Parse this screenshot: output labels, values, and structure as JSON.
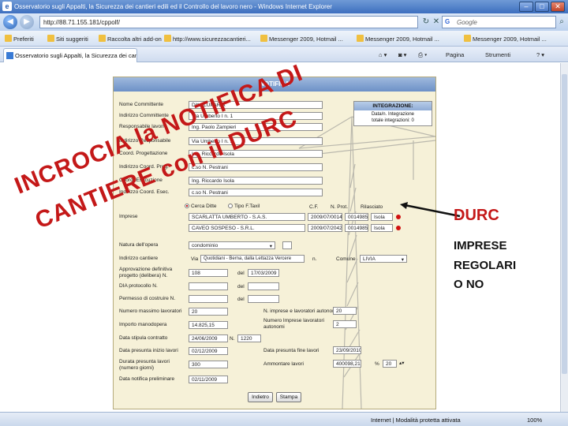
{
  "window": {
    "title": "Osservatorio sugli Appalti, la Sicurezza dei cantieri edili ed il Controllo del lavoro nero - Windows Internet Explorer"
  },
  "addressbar": {
    "url": "http://88.71.155.181/cppolf/",
    "search_placeholder": "Google"
  },
  "favorites": [
    {
      "label": "Preferiti"
    },
    {
      "label": "Siti suggeriti"
    },
    {
      "label": "Raccolta altri add-on"
    },
    {
      "label": "http://www.sicurezzacantieri..."
    },
    {
      "label": "Messenger 2009, Hotmail ..."
    },
    {
      "label": "Messenger 2009, Hotmail ..."
    },
    {
      "label": "Messenger 2009, Hotmail ..."
    }
  ],
  "tab": {
    "label": "Osservatorio sugli Appalti, la Sicurezza dei cantieri..."
  },
  "commandbar": {
    "page": "Pagina",
    "tools": "Strumenti"
  },
  "status": {
    "text": "Internet | Modalità protetta attivata",
    "zoom": "100%"
  },
  "form": {
    "header": "NOTIFICA",
    "fields": [
      {
        "label": "Nome Committente",
        "value": "Ditta LUPARIA"
      },
      {
        "label": "Indirizzo Committente",
        "value": "Via Umberto I n. 1"
      },
      {
        "label": "Responsabile lavori",
        "value": "Ing. Paolo Zampieri"
      },
      {
        "label": "Indirizzo Responsabile",
        "value": "Via Umberto I n. 1"
      },
      {
        "label": "Coord. Progettazione",
        "value": "Ing. Riccardo Isola"
      },
      {
        "label": "Indirizzo Coord. Prog.",
        "value": "c.so N. Pestrani"
      },
      {
        "label": "Coord. Esecuzione",
        "value": "Ing. Riccardo Isola"
      },
      {
        "label": "Indirizzo Coord. Esec.",
        "value": "c.so N. Pestrani"
      }
    ],
    "integration": {
      "title": "INTEGRAZIONE:",
      "line1": "Data/n. Integrazione",
      "line2": "totale integrazioni: 0"
    },
    "imprese": {
      "label": "Imprese",
      "radio1": "Cerca Ditte",
      "radio2": "Tipo F.Taxil",
      "col_cf": "C.F.",
      "col_prot": "N. Prot.",
      "col_rilascio": "Rilasciato",
      "rows": [
        {
          "name": "SCARLATTA UMBERTO - S.A.S.",
          "cf": "2009/07/001455",
          "prot": "0014985",
          "date": "Isola"
        },
        {
          "name": "CAVEO SOSPESO - S.R.L.",
          "cf": "2009/07/204293",
          "prot": "0014985",
          "date": "Isola"
        }
      ]
    },
    "natura": {
      "label": "Natura dell'opera",
      "value": "condominio"
    },
    "indirizzo_cantiere": {
      "label": "Indirizzo cantiere",
      "prefix": "Via",
      "value": "Quotidiani - Berna, dalla Lettazza Vercere",
      "n_label": "n.",
      "comune_label": "Comune",
      "comune": "LIVIA"
    },
    "approvazione": {
      "label": "Approvazione definitiva progetto (delibera) N.",
      "value": "108",
      "del": "del",
      "date": "17/03/2009"
    },
    "dia": {
      "label": "DIA protocollo N.",
      "del": "del"
    },
    "permesso": {
      "label": "Permesso di costruire N.",
      "del": "del"
    },
    "lavoratori": {
      "label": "Numero massimo lavoratori",
      "value": "20",
      "label2": "N. imprese e lavoratori autonomi",
      "value2": "20"
    },
    "importo": {
      "label": "Importo manodopera",
      "value": "14.825,15",
      "label2": "Numero Imprese lavoratori autonomi",
      "value2": "2"
    },
    "contratto": {
      "label": "Data stipula contratto",
      "value": "24/06/2009",
      "n_label": "N.",
      "n_value": "1220"
    },
    "inizio": {
      "label": "Data presunta inizio lavori",
      "value": "02/12/2009",
      "label2": "Data presunta fine lavori",
      "value2": "23/09/2010"
    },
    "durata": {
      "label": "Durata presunta lavori (numero giorni)",
      "value": "300",
      "label2": "Ammontare lavori",
      "value2": "400098,21",
      "pct_label": "%",
      "pct_value": "20"
    },
    "notifica": {
      "label": "Data notifica preliminare",
      "value": "02/11/2009"
    },
    "buttons": {
      "back": "Indietro",
      "print": "Stampa"
    }
  },
  "overlay": {
    "line1": "INCROCIA la NOTIFICA DI",
    "line2": "CANTIERE con il DURC"
  },
  "side": {
    "title": "DURC",
    "l1": "IMPRESE",
    "l2": "REGOLARI",
    "l3": "O  NO"
  },
  "colors": {
    "overlay_red": "#c41818",
    "form_bg": "#f6f1d8",
    "header_blue": "#6d91c7"
  }
}
